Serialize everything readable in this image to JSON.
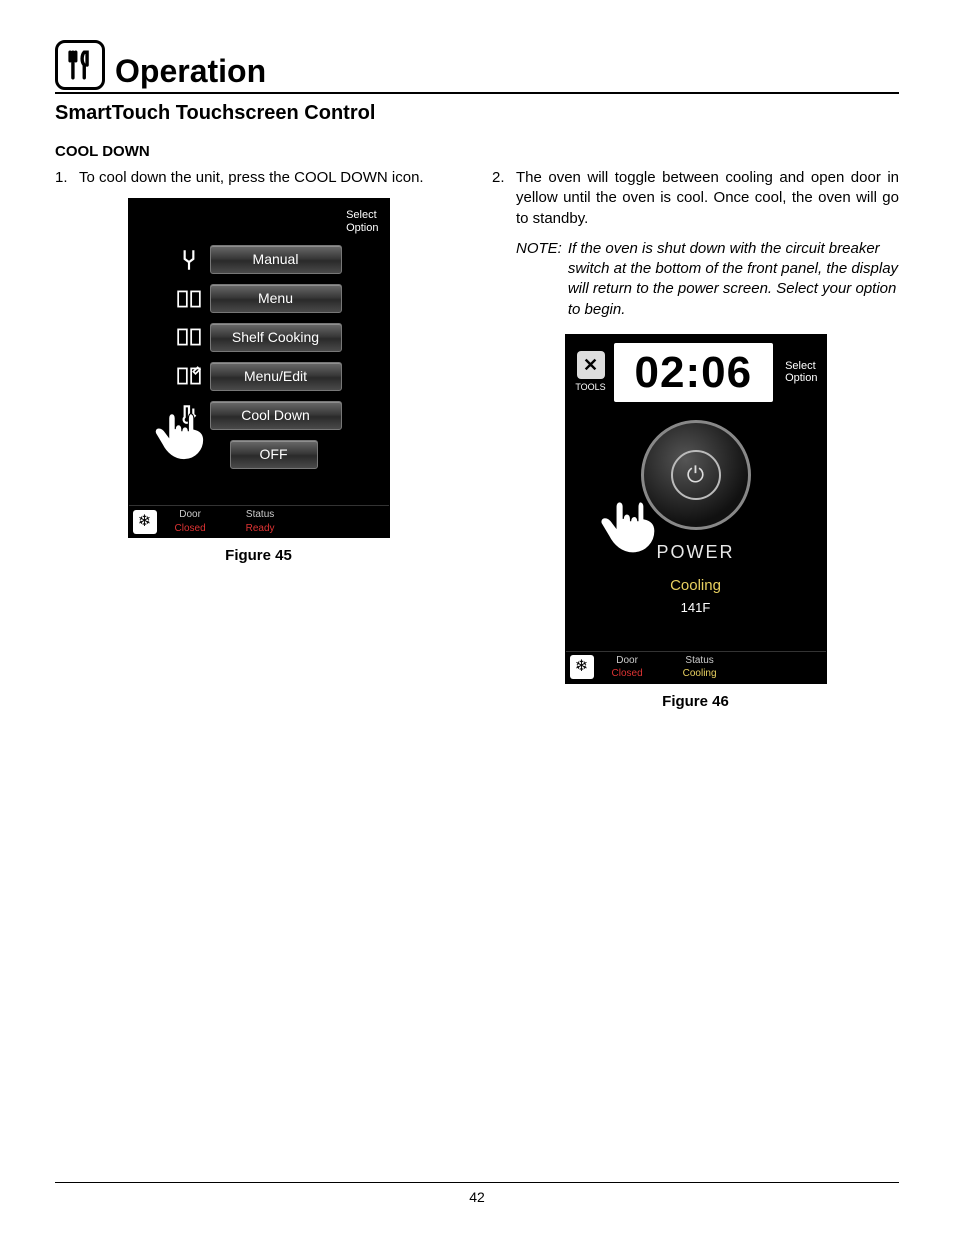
{
  "chapter": {
    "title": "Operation"
  },
  "section": {
    "title": "SmartTouch Touchscreen Control"
  },
  "subsection": {
    "title": "COOL DOWN"
  },
  "steps": {
    "s1_num": "1.",
    "s1_text": "To cool down the unit, press the COOL DOWN icon.",
    "s2_num": "2.",
    "s2_text": "The oven will toggle between cooling and open door in yellow until the oven is cool. Once cool, the oven will go to standby."
  },
  "note": {
    "label": "NOTE:",
    "text": "If the oven is shut down with the circuit breaker switch at the bottom of the front panel, the display will return to the power screen. Select your option to begin."
  },
  "fig45": {
    "caption": "Figure 45",
    "select_label_1": "Select",
    "select_label_2": "Option",
    "buttons": {
      "manual": "Manual",
      "menu": "Menu",
      "shelf": "Shelf  Cooking",
      "menuedit": "Menu/Edit",
      "cooldown": "Cool  Down",
      "off": "OFF"
    },
    "status": {
      "door_label": "Door",
      "door_value": "Closed",
      "status_label": "Status",
      "status_value": "Ready"
    }
  },
  "fig46": {
    "caption": "Figure 46",
    "select_label_1": "Select",
    "select_label_2": "Option",
    "tools_label": "TOOLS",
    "clock": "02:06",
    "power_label": "POWER",
    "cooling_label": "Cooling",
    "temp": "141F",
    "status": {
      "door_label": "Door",
      "door_value": "Closed",
      "status_label": "Status",
      "status_value": "Cooling"
    }
  },
  "page_number": "42"
}
